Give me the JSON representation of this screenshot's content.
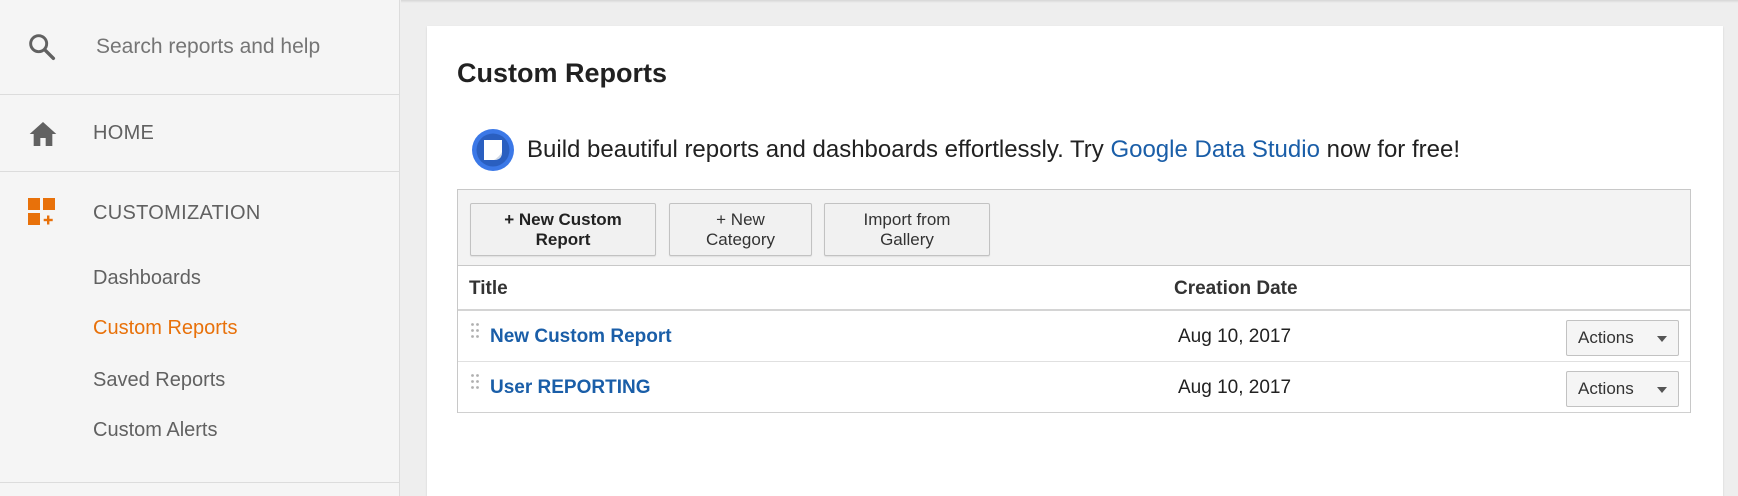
{
  "sidebar": {
    "search": {
      "placeholder": "Search reports and help",
      "value": "",
      "icon": "search-icon"
    },
    "home": {
      "label": "HOME",
      "icon": "home-icon"
    },
    "customization": {
      "label": "CUSTOMIZATION",
      "icon": "customization-icon",
      "items": [
        {
          "label": "Dashboards",
          "active": false
        },
        {
          "label": "Custom Reports",
          "active": true
        },
        {
          "label": "Saved Reports",
          "active": false
        },
        {
          "label": "Custom Alerts",
          "active": false
        }
      ]
    }
  },
  "main": {
    "title": "Custom Reports",
    "promo": {
      "text_before": "Build beautiful reports and dashboards effortlessly. Try ",
      "link": "Google Data Studio",
      "text_after": " now for free!",
      "icon": "data-studio-icon"
    },
    "toolbar": {
      "new_report": "+ New Custom Report",
      "new_category": "+ New Category",
      "import": "Import from Gallery"
    },
    "table": {
      "columns": [
        "Title",
        "Creation Date"
      ],
      "rows": [
        {
          "title": "New Custom Report",
          "date": "Aug 10, 2017",
          "actions": "Actions"
        },
        {
          "title": "User REPORTING",
          "date": "Aug 10, 2017",
          "actions": "Actions"
        }
      ]
    }
  },
  "colors": {
    "accent": "#e8710a",
    "link": "#1a5ea8",
    "sidebar_bg": "#f5f5f5"
  }
}
